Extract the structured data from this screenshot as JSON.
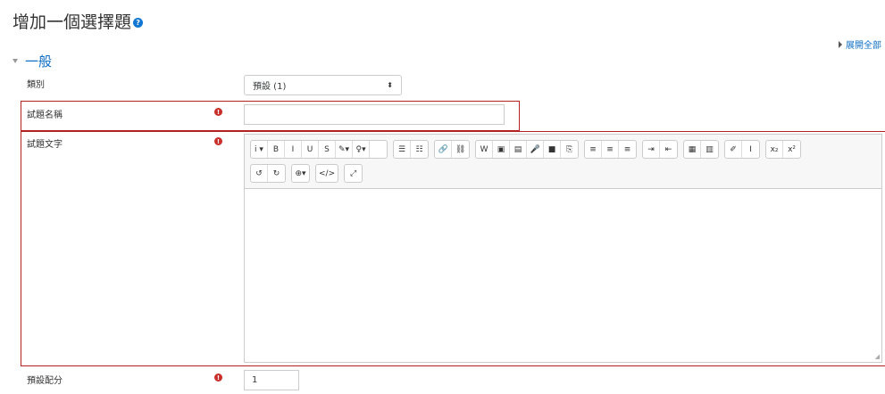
{
  "page": {
    "title": "增加一個選擇題",
    "expand_all": "展開全部"
  },
  "section": {
    "title": "一般"
  },
  "fields": {
    "category": {
      "label": "類別",
      "value": "預設 (1)"
    },
    "question_name": {
      "label": "試題名稱",
      "value": ""
    },
    "question_text": {
      "label": "試題文字"
    },
    "default_mark": {
      "label": "預設配分",
      "value": "1"
    }
  },
  "editor": {
    "row1": [
      [
        "info-icon",
        "style-dropdown",
        "bold-button",
        "italic-button",
        "underline-button",
        "strikethrough-button",
        "font-color-dropdown",
        "background-color-dropdown"
      ],
      [
        "unordered-list-button",
        "ordered-list-button"
      ],
      [
        "link-button",
        "unlink-button"
      ],
      [
        "word-import-button",
        "image-button",
        "media-button",
        "record-audio-button",
        "record-video-button",
        "manage-files-button"
      ],
      [
        "align-left-button",
        "align-center-button",
        "align-right-button"
      ],
      [
        "indent-button",
        "outdent-button"
      ],
      [
        "table-button",
        "calculator-button"
      ],
      [
        "clear-format-button",
        "text-cursor-button"
      ],
      [
        "subscript-button",
        "superscript-button"
      ]
    ],
    "row2": [
      [
        "undo-button",
        "redo-button"
      ],
      [
        "language-dropdown"
      ],
      [
        "html-button"
      ],
      [
        "fullscreen-button"
      ]
    ]
  },
  "glyphs": {
    "info-icon": "i ▾",
    "style-dropdown": "B",
    "bold-button": "I",
    "italic-button": "U",
    "underline-button": "S",
    "strikethrough-button": "✎▾",
    "font-color-dropdown": "♀▾",
    "unordered-list-button": "☰",
    "ordered-list-button": "☷",
    "link-button": "🔗",
    "unlink-button": "⛓",
    "word-import-button": "W",
    "image-button": "▣",
    "media-button": "▤",
    "record-audio-button": "🎤",
    "record-video-button": "■",
    "manage-files-button": "⎘",
    "align-left-button": "≡",
    "align-center-button": "≡",
    "align-right-button": "≡",
    "indent-button": "⇥",
    "outdent-button": "⇤",
    "table-button": "▦",
    "calculator-button": "▥",
    "clear-format-button": "✐",
    "text-cursor-button": "I",
    "subscript-button": "x₂",
    "superscript-button": "x²",
    "undo-button": "↺",
    "redo-button": "↻",
    "language-dropdown": "⊕▾",
    "html-button": "</>",
    "fullscreen-button": "⤢"
  }
}
